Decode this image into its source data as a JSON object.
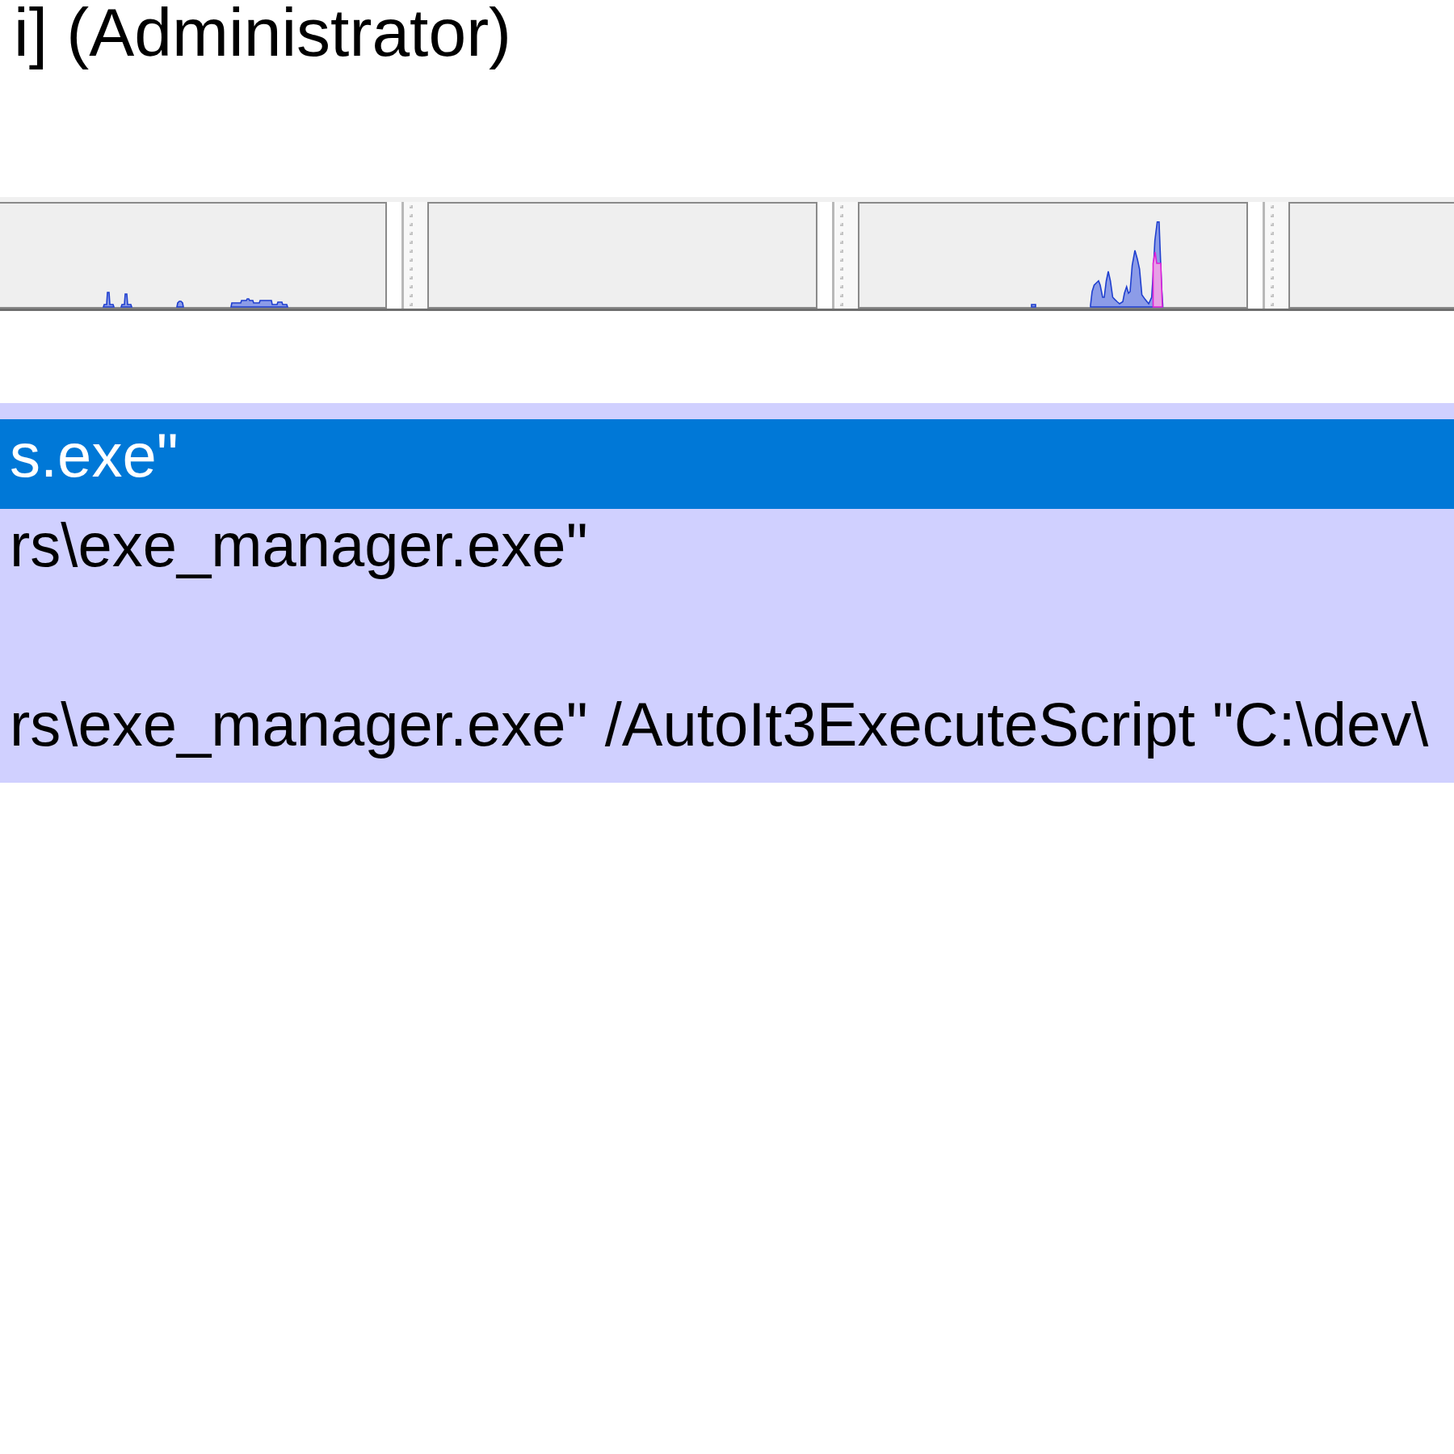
{
  "title_bar": {
    "title": "i] (Administrator)"
  },
  "toolbar": {
    "graphs": [
      {
        "kind": "quiet"
      },
      {
        "kind": "blank"
      },
      {
        "kind": "burst"
      },
      {
        "kind": "blank"
      }
    ]
  },
  "process_list": {
    "rows": [
      {
        "text": "s.exe\"",
        "selected": true
      },
      {
        "text": "rs\\exe_manager.exe\"",
        "selected": false
      },
      {
        "selected": false
      },
      {
        "text": "rs\\exe_manager.exe\" /AutoIt3ExecuteScript \"C:\\dev\\",
        "selected": false
      }
    ]
  }
}
